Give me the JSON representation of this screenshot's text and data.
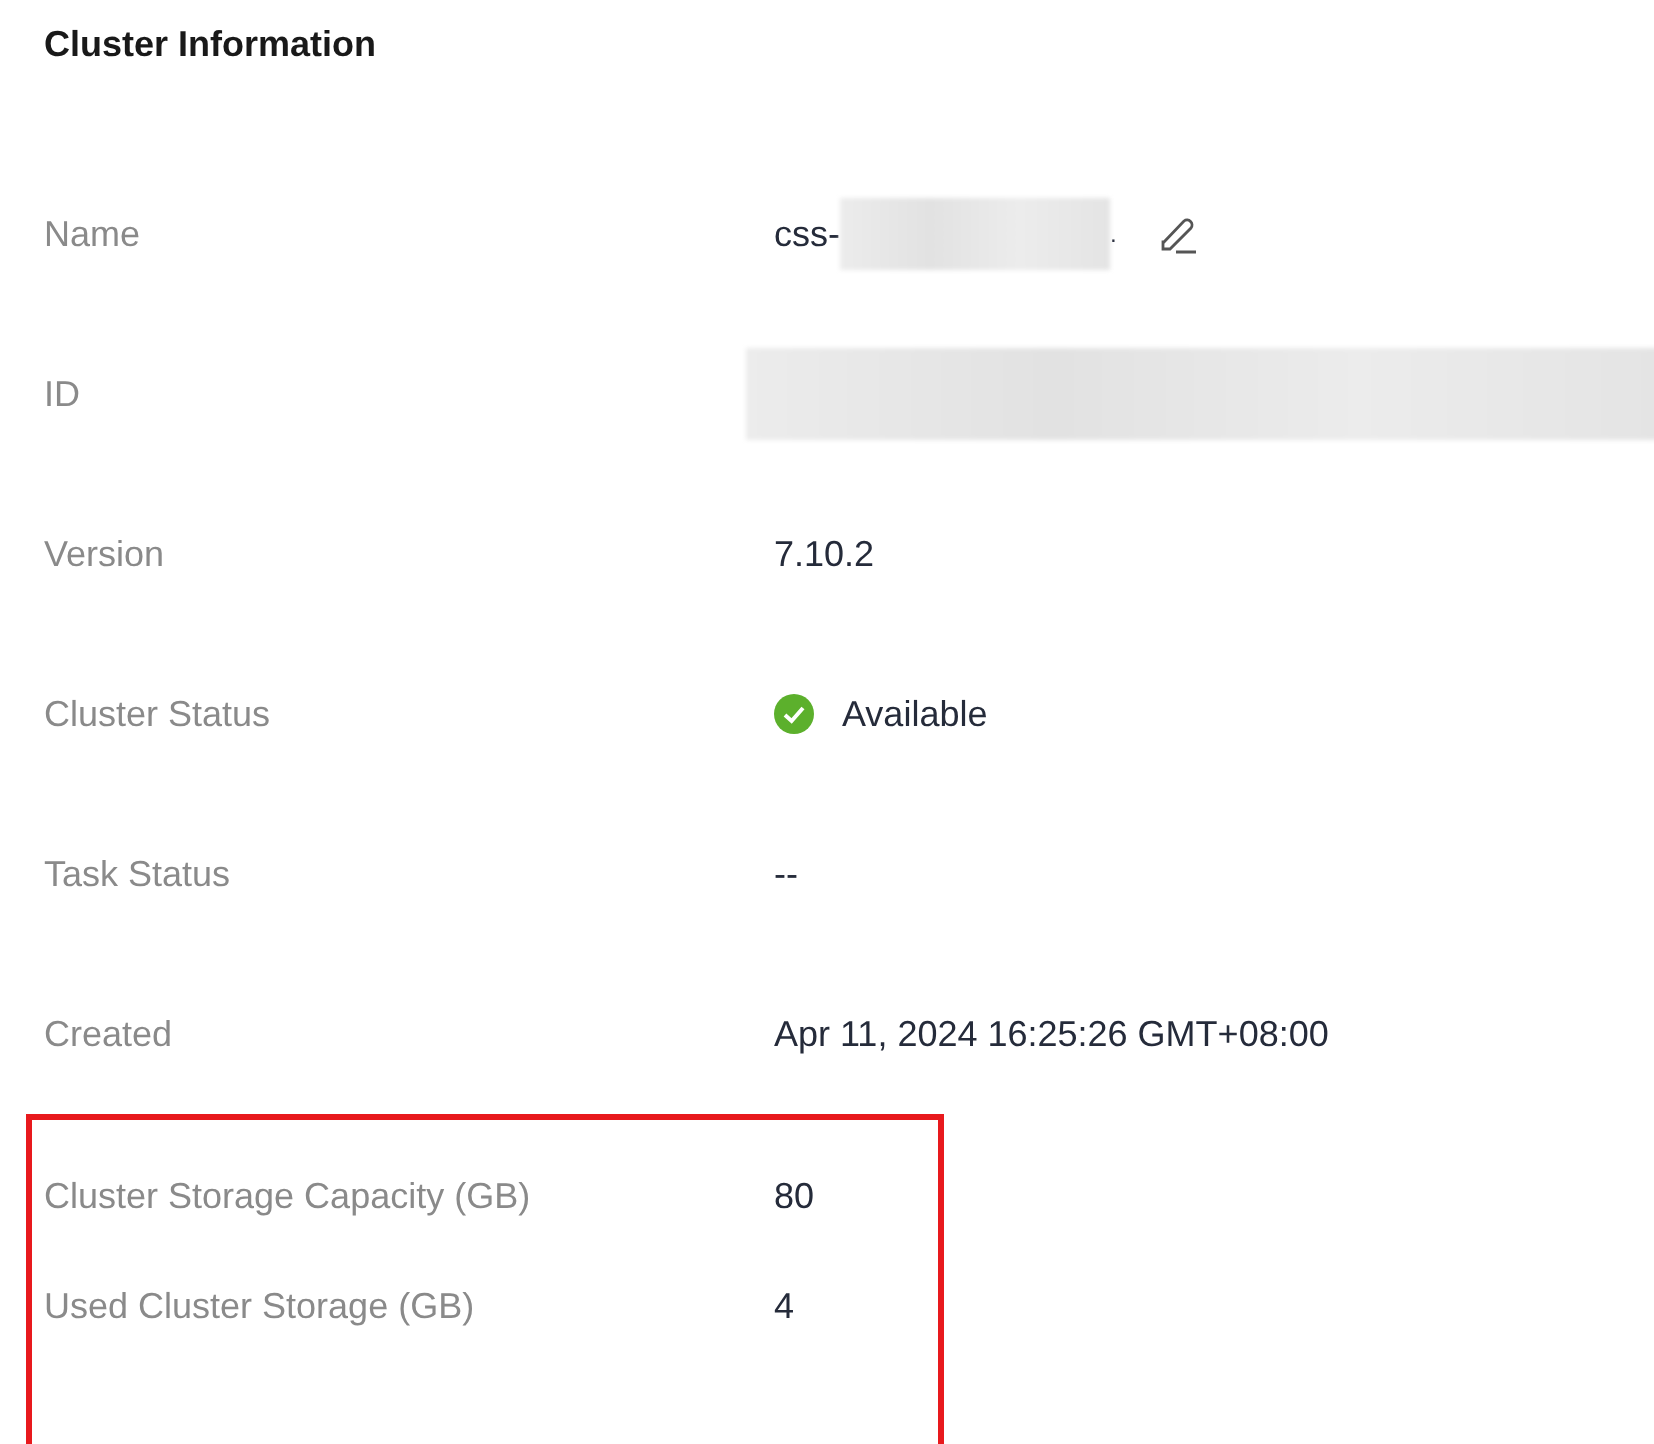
{
  "title": "Cluster Information",
  "rows": [
    {
      "kind": "name",
      "label": "Name",
      "prefix": "css-",
      "suffix": ".",
      "highlighted": false
    },
    {
      "kind": "redacted",
      "label": "ID",
      "highlighted": false
    },
    {
      "kind": "text",
      "label": "Version",
      "value": "7.10.2",
      "highlighted": false
    },
    {
      "kind": "status",
      "label": "Cluster Status",
      "value": "Available",
      "highlighted": false
    },
    {
      "kind": "text",
      "label": "Task Status",
      "value": "--",
      "highlighted": false
    },
    {
      "kind": "text",
      "label": "Created",
      "value": "Apr 11, 2024 16:25:26 GMT+08:00",
      "highlighted": false
    },
    {
      "kind": "text",
      "label": "Cluster Storage Capacity (GB)",
      "value": "80",
      "highlighted": true
    },
    {
      "kind": "text",
      "label": "Used Cluster Storage (GB)",
      "value": "4",
      "highlighted": true
    }
  ]
}
